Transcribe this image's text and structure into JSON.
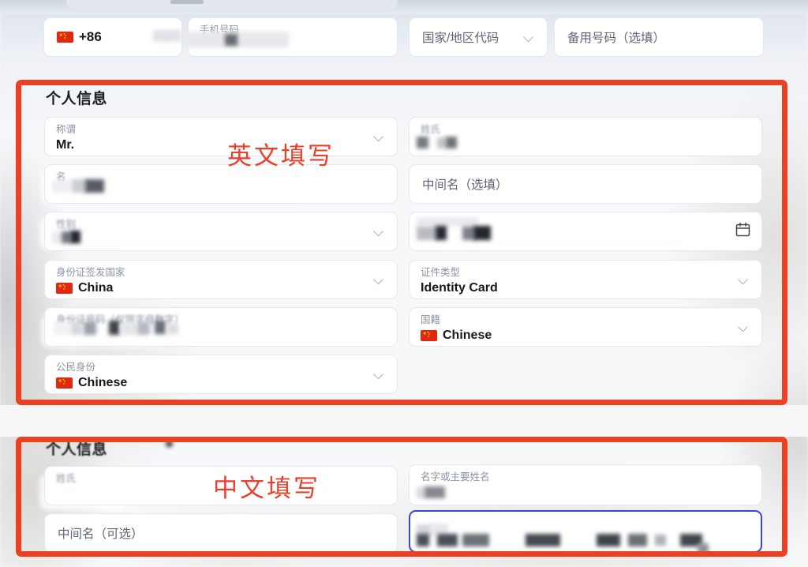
{
  "meta": {
    "accent_red": "#ec4022",
    "annotation_red": "#e8402a",
    "field_border": "#e3e8ef",
    "focus_border": "#3b44d6",
    "label_color": "#8b93a3",
    "value_color": "#16181d"
  },
  "contact_row": {
    "country_code": {
      "value": "+86",
      "flag": "cn-flag-icon"
    },
    "phone": {
      "label": "手机号码",
      "value_redacted": true
    },
    "region_code": {
      "placeholder": "国家/地区代码",
      "chevron": "chevron-down-icon"
    },
    "spare_phone": {
      "placeholder": "备用号码（选填）"
    }
  },
  "english_section": {
    "title": "个人信息",
    "annotation": "英文填写",
    "fields": {
      "title_salutation": {
        "label": "称谓",
        "value": "Mr.",
        "chevron": "chevron-down-icon"
      },
      "surname": {
        "label": "姓氏",
        "label_blurred": true,
        "value_redacted": true
      },
      "given_name": {
        "label": "名",
        "value_redacted": true
      },
      "middle_name": {
        "placeholder": "中间名（选填）"
      },
      "gender": {
        "label": "性别",
        "label_blurred": true,
        "value_redacted": true,
        "chevron": "chevron-down-icon"
      },
      "birth_date": {
        "label_redacted": true,
        "value_redacted": true,
        "icon": "calendar-icon"
      },
      "id_issue_country": {
        "label": "身份证签发国家",
        "value": "China",
        "flag": "cn-flag-icon",
        "chevron": "chevron-down-icon"
      },
      "document_type": {
        "label": "证件类型",
        "value": "Identity Card",
        "chevron": "chevron-down-icon"
      },
      "id_number": {
        "label": "身份证号码（仅限字母数字）",
        "label_blurred": true,
        "value_redacted": true
      },
      "nationality": {
        "label": "国籍",
        "value": "Chinese",
        "flag": "cn-flag-icon",
        "chevron": "chevron-down-icon"
      },
      "citizenship": {
        "label": "公民身份",
        "value": "Chinese",
        "flag": "cn-flag-icon",
        "chevron": "chevron-down-icon"
      }
    }
  },
  "chinese_section": {
    "title": "个人信息",
    "annotation": "中文填写",
    "fields": {
      "surname_cn": {
        "label": "姓氏",
        "label_blurred": true
      },
      "given_name_cn": {
        "label": "名字或主要姓名",
        "value_redacted": true
      },
      "middle_name_cn": {
        "placeholder": "中间名（可选）"
      },
      "focused_field": {
        "focused": true,
        "value_redacted": true
      }
    }
  }
}
